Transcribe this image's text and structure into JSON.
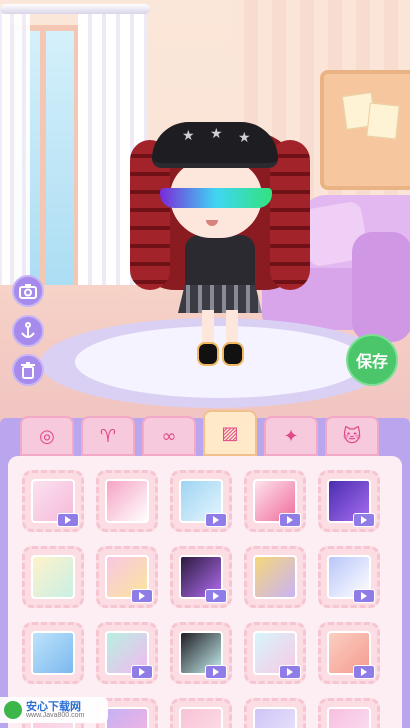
{
  "scene": {
    "save_button_label": "保存",
    "side_tools": [
      {
        "icon": "camera-icon",
        "glyph": "📷"
      },
      {
        "icon": "anchor-icon",
        "glyph": "⚓"
      },
      {
        "icon": "trash-icon",
        "glyph": "🗑"
      }
    ]
  },
  "tabs": [
    {
      "icon": "ring-icon",
      "glyph": "◎",
      "active": false
    },
    {
      "icon": "headband-icon",
      "glyph": "♈",
      "active": false
    },
    {
      "icon": "glasses-icon",
      "glyph": "∞",
      "active": false
    },
    {
      "icon": "background-image-icon",
      "glyph": "▨",
      "active": true
    },
    {
      "icon": "magic-wand-icon",
      "glyph": "✦",
      "active": false
    },
    {
      "icon": "cat-icon",
      "glyph": "🐱",
      "active": false
    }
  ],
  "backgrounds": [
    {
      "name": "bow-pattern",
      "colors": [
        "#fbe2f0",
        "#f5b9d9"
      ],
      "video": true
    },
    {
      "name": "pink-checker",
      "colors": [
        "#f6a3c4",
        "#ffffff"
      ],
      "video": false
    },
    {
      "name": "blue-hearts",
      "colors": [
        "#9ed4f3",
        "#e5f5fd"
      ],
      "video": true
    },
    {
      "name": "heart-dots",
      "colors": [
        "#fde3ec",
        "#f06b9c"
      ],
      "video": true
    },
    {
      "name": "galaxy-purple",
      "colors": [
        "#4a2db0",
        "#a86df0"
      ],
      "video": true
    },
    {
      "name": "pastel-grid",
      "colors": [
        "#fff2c9",
        "#c9f0e6"
      ],
      "video": false
    },
    {
      "name": "rainbow-stars",
      "colors": [
        "#f9c6e4",
        "#fbe69b"
      ],
      "video": true
    },
    {
      "name": "purple-checker",
      "colors": [
        "#2b1b3f",
        "#b36df2"
      ],
      "video": true
    },
    {
      "name": "lilac-hearts",
      "colors": [
        "#f6d77a",
        "#c9b3f6"
      ],
      "video": false
    },
    {
      "name": "blue-star",
      "colors": [
        "#b9c6f9",
        "#ffffff"
      ],
      "video": true
    },
    {
      "name": "blue-bubbles",
      "colors": [
        "#bde3fb",
        "#7cb9ee"
      ],
      "video": false
    },
    {
      "name": "holo-swirl",
      "colors": [
        "#b7f0e0",
        "#f3b8f0"
      ],
      "video": true
    },
    {
      "name": "drip-checker",
      "colors": [
        "#1e1e24",
        "#c8f0f0"
      ],
      "video": true
    },
    {
      "name": "pastel-stripes",
      "colors": [
        "#d6f5fb",
        "#f8c9e6"
      ],
      "video": true
    },
    {
      "name": "peach-hearts",
      "colors": [
        "#fbd0c2",
        "#f49a8f"
      ],
      "video": true
    },
    {
      "name": "pink-pattern",
      "colors": [
        "#fbc9dd",
        "#f6e3f0"
      ],
      "video": false
    },
    {
      "name": "butterfly-rainbow",
      "colors": [
        "#c5b1f5",
        "#fbb4de"
      ],
      "video": false
    },
    {
      "name": "pink-room",
      "colors": [
        "#f8c2d5",
        "#fde2ea"
      ],
      "video": false
    },
    {
      "name": "lavender-haze",
      "colors": [
        "#cfc4f6",
        "#eee9fd"
      ],
      "video": false
    },
    {
      "name": "pink-stars",
      "colors": [
        "#f7bfe0",
        "#fbe3f1"
      ],
      "video": false
    }
  ],
  "watermark": {
    "title": "安心下载网",
    "url": "www.Java800.com"
  }
}
